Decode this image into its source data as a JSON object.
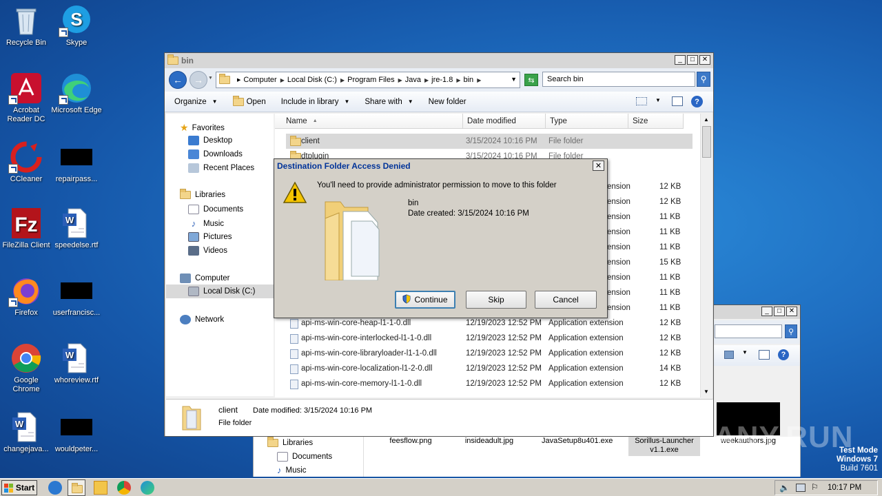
{
  "desktop": {
    "icons": [
      {
        "label": "Recycle Bin"
      },
      {
        "label": "Skype"
      },
      {
        "label": "Acrobat Reader DC"
      },
      {
        "label": "Microsoft Edge"
      },
      {
        "label": "CCleaner"
      },
      {
        "label": "repairpass..."
      },
      {
        "label": "FileZilla Client"
      },
      {
        "label": "speedelse.rtf"
      },
      {
        "label": "Firefox"
      },
      {
        "label": "userfrancisc..."
      },
      {
        "label": "Google Chrome"
      },
      {
        "label": "whoreview.rtf"
      },
      {
        "label": "changejava..."
      },
      {
        "label": "wouldpeter..."
      }
    ],
    "watermark": {
      "line1": "Test Mode",
      "line2": "Windows 7",
      "line3": "Build 7601"
    },
    "brand": "ANY.RUN"
  },
  "explorer": {
    "title": "bin",
    "breadcrumb": [
      "Computer",
      "Local Disk (C:)",
      "Program Files",
      "Java",
      "jre-1.8",
      "bin"
    ],
    "search_placeholder": "Search bin",
    "toolbar": {
      "organize": "Organize",
      "open": "Open",
      "include": "Include in library",
      "share": "Share with",
      "new_folder": "New folder"
    },
    "nav": {
      "favorites": "Favorites",
      "desktop": "Desktop",
      "downloads": "Downloads",
      "recent": "Recent Places",
      "libraries": "Libraries",
      "documents": "Documents",
      "music": "Music",
      "pictures": "Pictures",
      "videos": "Videos",
      "computer": "Computer",
      "local_disk": "Local Disk (C:)",
      "network": "Network"
    },
    "columns": {
      "name": "Name",
      "date": "Date modified",
      "type": "Type",
      "size": "Size"
    },
    "rows_top": [
      {
        "name": "client",
        "date": "3/15/2024 10:16 PM",
        "type": "File folder",
        "size": ""
      },
      {
        "name": "dtplugin",
        "date": "3/15/2024 10:16 PM",
        "type": "File folder",
        "size": ""
      }
    ],
    "rows_partial": [
      {
        "type": "ension",
        "size": "12 KB"
      },
      {
        "type": "ension",
        "size": "12 KB"
      },
      {
        "type": "ension",
        "size": "11 KB"
      },
      {
        "type": "ension",
        "size": "11 KB"
      },
      {
        "type": "ension",
        "size": "11 KB"
      },
      {
        "type": "ension",
        "size": "15 KB"
      },
      {
        "type": "ension",
        "size": "11 KB"
      },
      {
        "type": "ension",
        "size": "11 KB"
      },
      {
        "type": "ension",
        "size": "11 KB"
      }
    ],
    "rows": [
      {
        "name": "api-ms-win-core-heap-l1-1-0.dll",
        "date": "12/19/2023 12:52 PM",
        "type": "Application extension",
        "size": "12 KB"
      },
      {
        "name": "api-ms-win-core-interlocked-l1-1-0.dll",
        "date": "12/19/2023 12:52 PM",
        "type": "Application extension",
        "size": "12 KB"
      },
      {
        "name": "api-ms-win-core-libraryloader-l1-1-0.dll",
        "date": "12/19/2023 12:52 PM",
        "type": "Application extension",
        "size": "12 KB"
      },
      {
        "name": "api-ms-win-core-localization-l1-2-0.dll",
        "date": "12/19/2023 12:52 PM",
        "type": "Application extension",
        "size": "14 KB"
      },
      {
        "name": "api-ms-win-core-memory-l1-1-0.dll",
        "date": "12/19/2023 12:52 PM",
        "type": "Application extension",
        "size": "12 KB"
      }
    ],
    "details": {
      "name": "client",
      "date_label": "Date modified:",
      "date_value": "3/15/2024 10:16 PM",
      "kind": "File folder"
    }
  },
  "dialog": {
    "title": "Destination Folder Access Denied",
    "message": "You'll need to provide administrator permission to move to this folder",
    "item_name": "bin",
    "item_created": "Date created: 3/15/2024 10:16 PM",
    "continue": "Continue",
    "skip": "Skip",
    "cancel": "Cancel"
  },
  "back_window": {
    "nav": {
      "libraries": "Libraries",
      "documents": "Documents",
      "music": "Music"
    },
    "files": [
      {
        "name": "feesflow.png"
      },
      {
        "name": "insideadult.jpg"
      },
      {
        "name": "JavaSetup8u401.exe"
      },
      {
        "name": "Sorillus-Launcher v1.1.exe"
      },
      {
        "name": "weekauthors.jpg"
      }
    ]
  },
  "taskbar": {
    "start": "Start",
    "clock": "10:17 PM"
  }
}
